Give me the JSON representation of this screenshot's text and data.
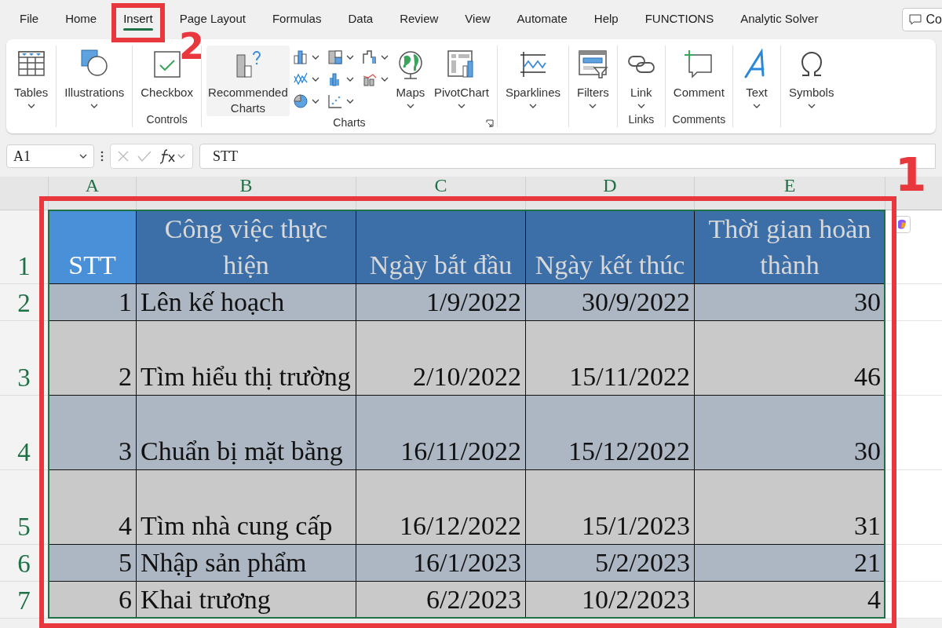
{
  "tabs": [
    {
      "label": "File",
      "selected": false
    },
    {
      "label": "Home",
      "selected": false
    },
    {
      "label": "Insert",
      "selected": true
    },
    {
      "label": "Page Layout",
      "selected": false
    },
    {
      "label": "Formulas",
      "selected": false
    },
    {
      "label": "Data",
      "selected": false
    },
    {
      "label": "Review",
      "selected": false
    },
    {
      "label": "View",
      "selected": false
    },
    {
      "label": "Automate",
      "selected": false
    },
    {
      "label": "Help",
      "selected": false
    },
    {
      "label": "FUNCTIONS",
      "selected": false
    },
    {
      "label": "Analytic Solver",
      "selected": false
    }
  ],
  "comments_button": {
    "label": "Co"
  },
  "ribbon": {
    "groups": [
      {
        "items": [
          {
            "kind": "large",
            "label": "Tables",
            "dropdown": true
          }
        ]
      },
      {
        "items": [
          {
            "kind": "large",
            "label": "Illustrations",
            "dropdown": true
          }
        ]
      },
      {
        "label": "Controls",
        "items": [
          {
            "kind": "large",
            "label": "Checkbox",
            "dropdown": false
          }
        ]
      },
      {
        "label": "Charts",
        "launcher": true,
        "items": [
          {
            "kind": "large",
            "label": "Recommended Charts",
            "dropdown": false
          },
          {
            "kind": "gallery"
          },
          {
            "kind": "large",
            "label": "Maps",
            "dropdown": true
          },
          {
            "kind": "large",
            "label": "PivotChart",
            "dropdown": true
          }
        ]
      },
      {
        "items": [
          {
            "kind": "large",
            "label": "Sparklines",
            "dropdown": true
          }
        ]
      },
      {
        "items": [
          {
            "kind": "large",
            "label": "Filters",
            "dropdown": true
          }
        ]
      },
      {
        "label": "Links",
        "items": [
          {
            "kind": "large",
            "label": "Link",
            "dropdown": true
          }
        ]
      },
      {
        "label": "Comments",
        "items": [
          {
            "kind": "large",
            "label": "Comment",
            "dropdown": false
          }
        ]
      },
      {
        "items": [
          {
            "kind": "large",
            "label": "Text",
            "dropdown": true
          }
        ]
      },
      {
        "items": [
          {
            "kind": "large",
            "label": "Symbols",
            "dropdown": true
          }
        ]
      }
    ]
  },
  "formula_bar": {
    "name_box": "A1",
    "value": "STT"
  },
  "sheet": {
    "columns": [
      "A",
      "B",
      "C",
      "D",
      "E"
    ],
    "selected_range": true,
    "header": {
      "row": "1",
      "cells": [
        {
          "text": "STT",
          "active": true
        },
        {
          "text": "Công việc thực hiện",
          "active": false
        },
        {
          "text": "Ngày bắt đầu",
          "active": false
        },
        {
          "text": "Ngày kết thúc",
          "active": false
        },
        {
          "text": "Thời gian hoàn thành",
          "active": false
        }
      ]
    },
    "rows": [
      {
        "row": "2",
        "cells": [
          "1",
          "Lên kế hoạch",
          "1/9/2022",
          "30/9/2022",
          "30"
        ]
      },
      {
        "row": "3",
        "cells": [
          "2",
          "Tìm hiểu thị trường",
          "2/10/2022",
          "15/11/2022",
          "46"
        ]
      },
      {
        "row": "4",
        "cells": [
          "3",
          "Chuẩn bị mặt bằng",
          "16/11/2022",
          "15/12/2022",
          "30"
        ]
      },
      {
        "row": "5",
        "cells": [
          "4",
          "Tìm nhà cung cấp",
          "16/12/2022",
          "15/1/2023",
          "31"
        ]
      },
      {
        "row": "6",
        "cells": [
          "5",
          "Nhập sản phẩm",
          "16/1/2023",
          "5/2/2023",
          "21"
        ]
      },
      {
        "row": "7",
        "cells": [
          "6",
          "Khai trương",
          "6/2/2023",
          "10/2/2023",
          "4"
        ]
      }
    ]
  },
  "annotations": [
    {
      "label": "2"
    },
    {
      "label": "1"
    }
  ]
}
